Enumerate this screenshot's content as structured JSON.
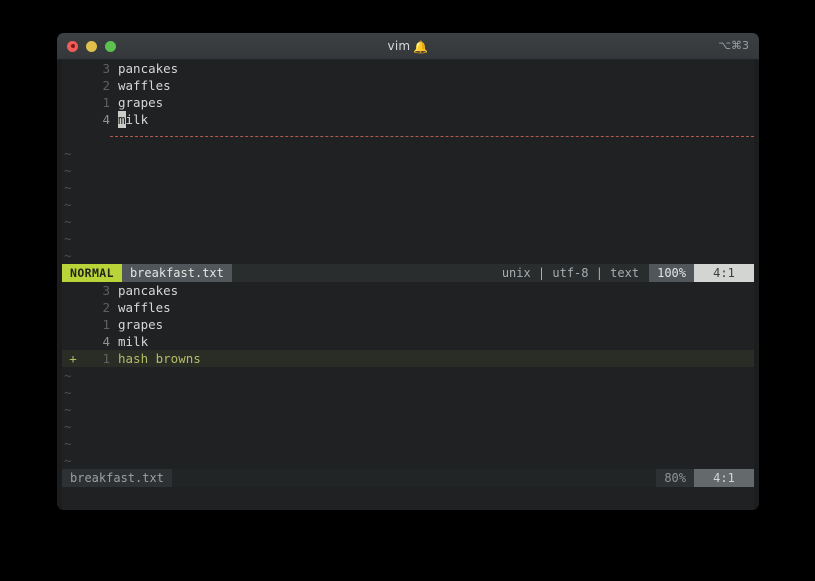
{
  "window": {
    "title": "vim",
    "title_icon": "bell-icon",
    "title_icon_glyph": "🔔",
    "shortcut": "⌥⌘3",
    "traffic_lights": {
      "close_label": "close",
      "minimize_label": "minimize",
      "zoom_label": "zoom"
    },
    "colors": {
      "titlebar_bg": "#3c4043",
      "terminal_bg": "#1f2122",
      "accent_green": "#b9d438",
      "added_text": "#b5bd68",
      "diff_rule": "#b05b50",
      "close_red": "#f15b58",
      "minimize_yellow": "#e0c04a",
      "zoom_green": "#5cc14e"
    }
  },
  "top_pane": {
    "lines": [
      {
        "sign": "",
        "number": "3",
        "text": "pancakes",
        "current": false,
        "added": false
      },
      {
        "sign": "",
        "number": "2",
        "text": "waffles",
        "current": false,
        "added": false
      },
      {
        "sign": "",
        "number": "1",
        "text": "grapes",
        "current": false,
        "added": false
      },
      {
        "sign": "",
        "number": "4",
        "text": "milk",
        "current": true,
        "added": false,
        "cursor_char": "m",
        "rest": "ilk"
      }
    ],
    "separator": "dashed-diff-rule",
    "tilde_count": 7,
    "tilde": "~",
    "statusline": {
      "mode": "NORMAL",
      "filename": "breakfast.txt",
      "fileformat": "unix",
      "encoding": "utf-8",
      "filetype": "text",
      "info": "unix | utf-8 | text",
      "percent": "100%",
      "position": "4:1"
    }
  },
  "bottom_pane": {
    "lines": [
      {
        "sign": "",
        "number": "3",
        "text": "pancakes",
        "current": false,
        "added": false
      },
      {
        "sign": "",
        "number": "2",
        "text": "waffles",
        "current": false,
        "added": false
      },
      {
        "sign": "",
        "number": "1",
        "text": "grapes",
        "current": false,
        "added": false
      },
      {
        "sign": "",
        "number": "4",
        "text": "milk",
        "current": true,
        "added": false
      },
      {
        "sign": "+",
        "number": "1",
        "text": "hash browns",
        "current": false,
        "added": true
      }
    ],
    "tilde_count": 6,
    "tilde": "~",
    "statusline": {
      "mode": "",
      "filename": "breakfast.txt",
      "info": "",
      "percent": "80%",
      "position": "4:1"
    }
  }
}
